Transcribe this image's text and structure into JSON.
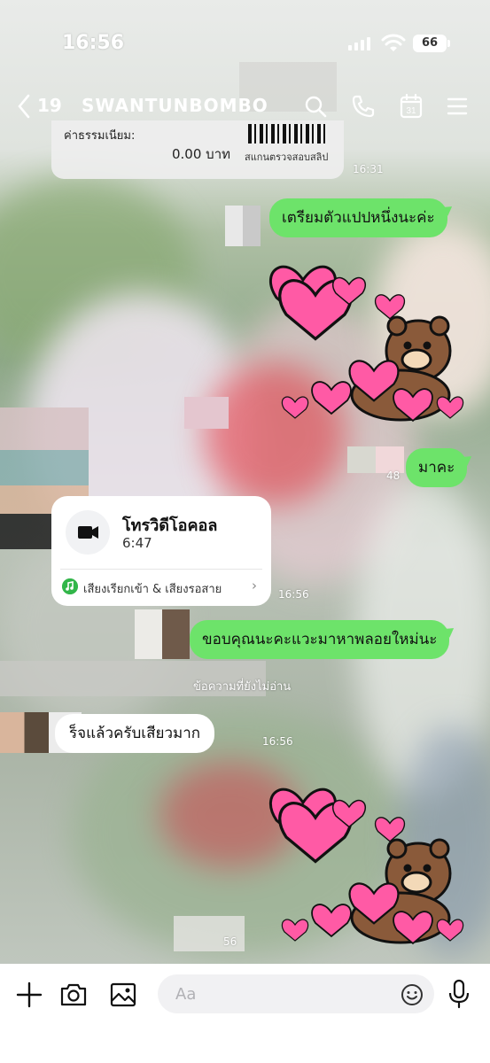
{
  "status_bar": {
    "time": "16:56",
    "battery": "66"
  },
  "header": {
    "back_count": "19",
    "chat_name": "SWANTUNBOMBO"
  },
  "messages": {
    "receipt": {
      "label": "ค่าธรรมเนียม:",
      "amount": "0.00 บาท",
      "verify_text": "สแกนตรวจสอบสลิป",
      "time": "16:31"
    },
    "out_1": "เตรียมตัวแปปหนึ่งนะค่ะ",
    "out_2": "มาคะ",
    "out_2_time": "48",
    "call": {
      "title": "โทรวิดีโอคอล",
      "duration": "6:47",
      "sound_label": "เสียงเรียกเข้า & เสียงรอสาย",
      "time": "16:56"
    },
    "out_3": "ขอบคุณนะคะแวะมาหาพลอยใหม่นะ",
    "unread_label": "ข้อความที่ยังไม่อ่าน",
    "in_1": "ร็จแล้วครับเสียวมาก",
    "in_1_time": "16:56",
    "last_time": "56"
  },
  "composer": {
    "placeholder": "Aa"
  },
  "colors": {
    "outgoing_bubble": "#6de36a",
    "incoming_bubble": "#ffffff",
    "sticker_heart": "#ff5aa5"
  },
  "icons": {
    "back": "chevron-left-icon",
    "search": "search-icon",
    "call": "phone-icon",
    "calendar": "calendar-icon",
    "menu": "menu-icon",
    "video": "video-camera-icon",
    "plus": "plus-icon",
    "camera": "camera-icon",
    "image": "image-icon",
    "emoji": "emoji-icon",
    "mic": "microphone-icon"
  }
}
